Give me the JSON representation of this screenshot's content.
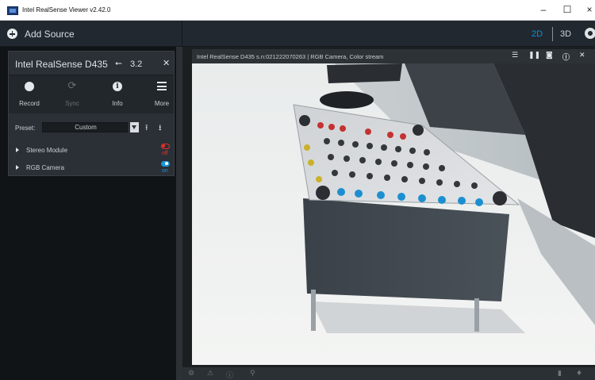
{
  "window": {
    "title": "Intel RealSense Viewer v2.42.0",
    "controls": {
      "minimize": "–",
      "maximize": "☐",
      "close": "×"
    }
  },
  "toolbar": {
    "add_source_label": "Add Source",
    "view_2d": "2D",
    "view_3d": "3D",
    "colors": {
      "active_view": "#0a8fd4"
    }
  },
  "device": {
    "name": "Intel RealSense D435",
    "usb_label": "3.2",
    "actions": [
      {
        "label": "Record",
        "icon": "record-icon"
      },
      {
        "label": "Sync",
        "icon": "sync-icon"
      },
      {
        "label": "Info",
        "icon": "info-icon"
      },
      {
        "label": "More",
        "icon": "menu-icon"
      }
    ],
    "preset": {
      "label": "Preset:",
      "value": "Custom"
    },
    "sensors": [
      {
        "name": "Stereo Module",
        "state": "off",
        "color": "#e0302b"
      },
      {
        "name": "RGB Camera",
        "state": "on",
        "color": "#1b95d9"
      }
    ]
  },
  "stream": {
    "title": "Intel RealSense D435 s.n:021222070263 | RGB Camera, Color stream",
    "buttons": [
      "list-icon",
      "pause-icon",
      "camera-icon",
      "info-icon",
      "close-icon"
    ]
  }
}
